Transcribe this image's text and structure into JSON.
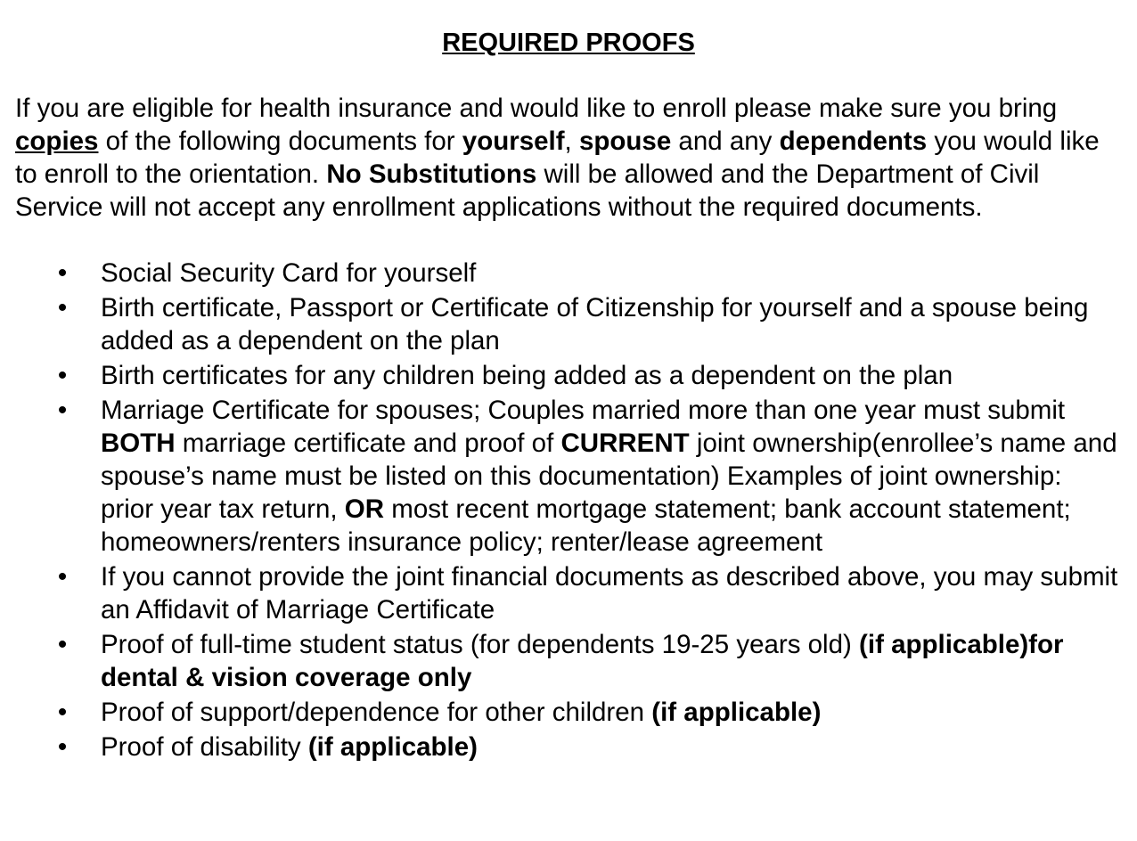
{
  "title": "REQUIRED PROOFS",
  "intro": {
    "t1": "If you are eligible for health insurance and would like to enroll please make sure you bring ",
    "copies": "copies",
    "t2": " of the following documents for ",
    "yourself": "yourself",
    "t3": ", ",
    "spouse": "spouse",
    "t4": " and any ",
    "dependents": "dependents",
    "t5": " you would like to enroll to the orientation. ",
    "no_sub": "No Substitutions",
    "t6": " will be allowed and the Department of Civil Service will not accept any enrollment applications without the required documents."
  },
  "bullet_char": "•",
  "items": {
    "i0": {
      "t": "Social Security Card for yourself"
    },
    "i1": {
      "t": "Birth certificate, Passport or Certificate of Citizenship for yourself and a spouse being added as a dependent on the plan"
    },
    "i2": {
      "t": "Birth certificates for any children being added as a dependent on the plan"
    },
    "i3": {
      "a": "Marriage Certificate for spouses; Couples married more than one year must submit ",
      "b": "BOTH",
      "c": " marriage certificate and proof of ",
      "d": "CURRENT",
      "e": " joint ownership(enrollee’s name and spouse’s name must be listed on this documentation) Examples of joint ownership: prior year tax return, ",
      "f": "OR",
      "g": " most recent mortgage statement; bank account statement; homeowners/renters insurance policy; renter/lease agreement"
    },
    "i4": {
      "t": "If you cannot provide the joint financial documents as described above, you may submit an Affidavit of Marriage Certificate"
    },
    "i5": {
      "a": "Proof of full-time student status (for dependents 19-25 years old) ",
      "b": "(if applicable)for dental & vision coverage only"
    },
    "i6": {
      "a": "Proof of support/dependence for other children ",
      "b": "(if applicable)"
    },
    "i7": {
      "a": "Proof of disability ",
      "b": "(if applicable)"
    }
  }
}
